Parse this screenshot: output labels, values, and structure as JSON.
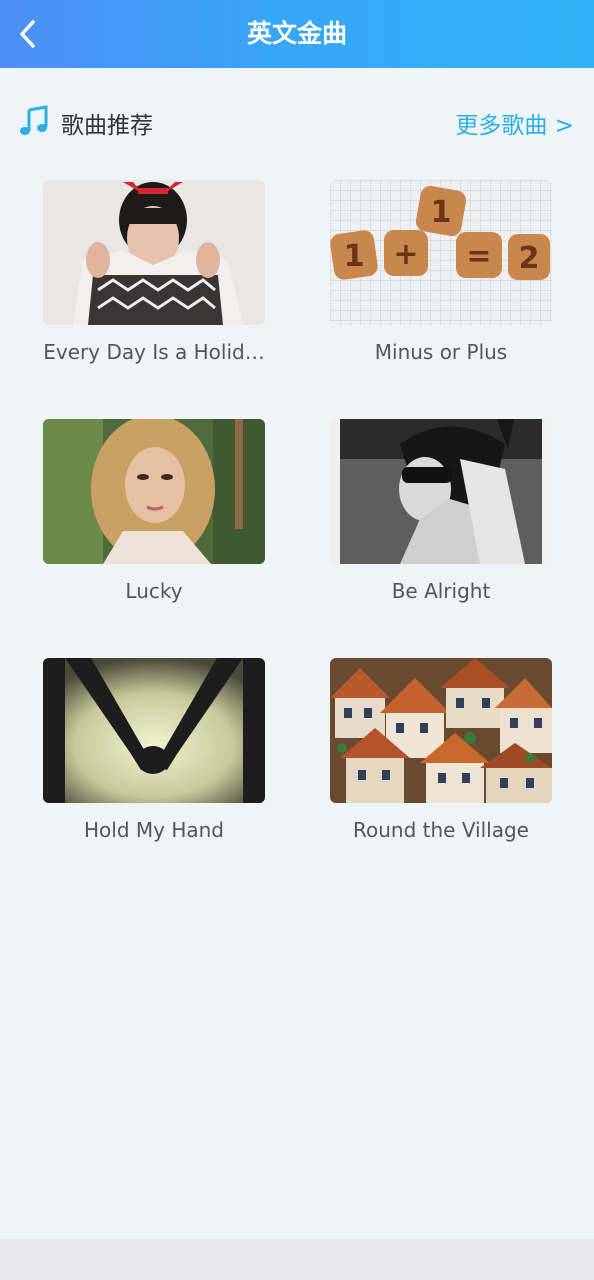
{
  "header": {
    "title": "英文金曲",
    "back_icon": "chevron-left-icon"
  },
  "section": {
    "title": "歌曲推荐",
    "icon": "music-note-icon",
    "more_label": "更多歌曲 >",
    "accent_color": "#2bb0e6"
  },
  "songs": [
    {
      "title": "Every Day Is a Holid…",
      "image": "woman holding knit sweater"
    },
    {
      "title": "Minus or Plus",
      "image": "number cookies on graph paper"
    },
    {
      "title": "Lucky",
      "image": "blonde woman portrait"
    },
    {
      "title": "Be Alright",
      "image": "black and white portrait with cat-ear mask"
    },
    {
      "title": "Hold My Hand",
      "image": "silhouette holding hands"
    },
    {
      "title": "Round the Village",
      "image": "miniature timber-frame houses"
    }
  ]
}
